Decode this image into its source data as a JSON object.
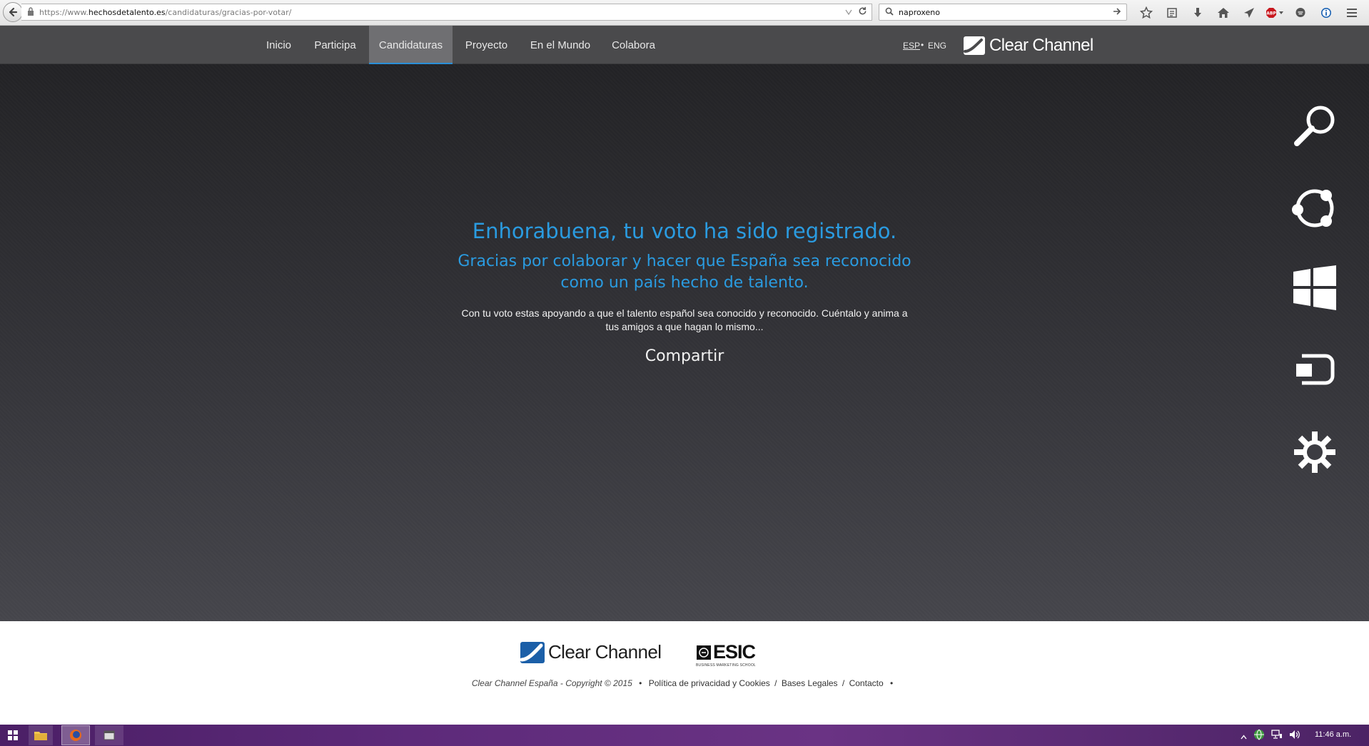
{
  "browser": {
    "url_prefix": "https://www.",
    "url_domain": "hechosdetalento.es",
    "url_path": "/candidaturas/gracias-por-votar/",
    "search_value": "naproxeno",
    "toolbar_icons": [
      "bookmark-star-icon",
      "reading-list-icon",
      "download-icon",
      "home-icon",
      "send-icon",
      "adblock-icon",
      "chat-icon",
      "info-icon",
      "menu-icon"
    ],
    "adblock_label": "ABP"
  },
  "nav": {
    "items": [
      {
        "label": "Inicio"
      },
      {
        "label": "Participa"
      },
      {
        "label": "Candidaturas",
        "active": true
      },
      {
        "label": "Proyecto"
      },
      {
        "label": "En el Mundo"
      },
      {
        "label": "Colabora"
      }
    ],
    "lang_esp": "ESP",
    "lang_dot": "•",
    "lang_eng": "ENG",
    "logo_text": "Clear Channel"
  },
  "hero": {
    "headline": "Enhorabuena, tu voto ha sido registrado.",
    "subheadline": "Gracias por colaborar y hacer que España sea reconocido como un país hecho de talento.",
    "body": "Con tu voto estas apoyando a que el talento español sea conocido y reconocido. Cuéntalo y anima a tus amigos a que hagan lo mismo...",
    "share_label": "Compartir"
  },
  "charms": [
    "search-icon",
    "share-icon",
    "start-icon",
    "devices-icon",
    "settings-icon"
  ],
  "footer": {
    "cc_logo_text": "Clear Channel",
    "esic_logo_text": "ESIC",
    "esic_tagline": "BUSINESS MARKETING SCHOOL",
    "copyright": "Clear Channel España - Copyright © 2015",
    "bullet": "•",
    "slash": "/",
    "links": {
      "privacy": "Política de privacidad y Cookies",
      "legal": "Bases Legales",
      "contact": "Contacto"
    }
  },
  "taskbar": {
    "clock": "11:46 a.m.",
    "pinned": [
      "file-explorer-icon",
      "firefox-icon",
      "app-window-icon"
    ]
  },
  "colors": {
    "accent_blue": "#2a9be0",
    "nav_bg": "#4a4a4c",
    "nav_active_bg": "#6f6f72",
    "taskbar_purple": "#5d2a7a"
  }
}
